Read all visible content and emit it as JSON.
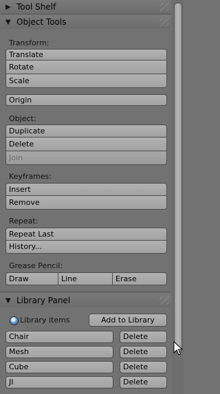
{
  "tool_shelf": {
    "title": "Tool Shelf"
  },
  "object_tools": {
    "title": "Object Tools",
    "transform": {
      "label": "Transform:",
      "buttons": [
        "Translate",
        "Rotate",
        "Scale"
      ]
    },
    "origin": "Origin",
    "object": {
      "label": "Object:",
      "buttons": [
        "Duplicate",
        "Delete",
        "Join"
      ]
    },
    "keyframes": {
      "label": "Keyframes:",
      "buttons": [
        "Insert",
        "Remove"
      ]
    },
    "repeat": {
      "label": "Repeat:",
      "buttons": [
        "Repeat Last",
        "History..."
      ]
    },
    "grease_pencil": {
      "label": "Grease Pencil:",
      "buttons": [
        "Draw",
        "Line",
        "Erase"
      ]
    }
  },
  "library_panel": {
    "title": "Library Panel",
    "items_label": "Library items",
    "add_button": "Add to Library",
    "items": [
      {
        "name": "Chair",
        "delete": "Delete"
      },
      {
        "name": "Mesh",
        "delete": "Delete"
      },
      {
        "name": "Cube",
        "delete": "Delete"
      },
      {
        "name": "JI",
        "delete": "Delete"
      }
    ]
  },
  "icons": {
    "collapsed_triangle": "triangle-right-icon",
    "expanded_triangle": "triangle-down-icon",
    "library": "globe-icon",
    "grip": "drag-grip-icon",
    "cursor": "mouse-pointer-icon"
  }
}
